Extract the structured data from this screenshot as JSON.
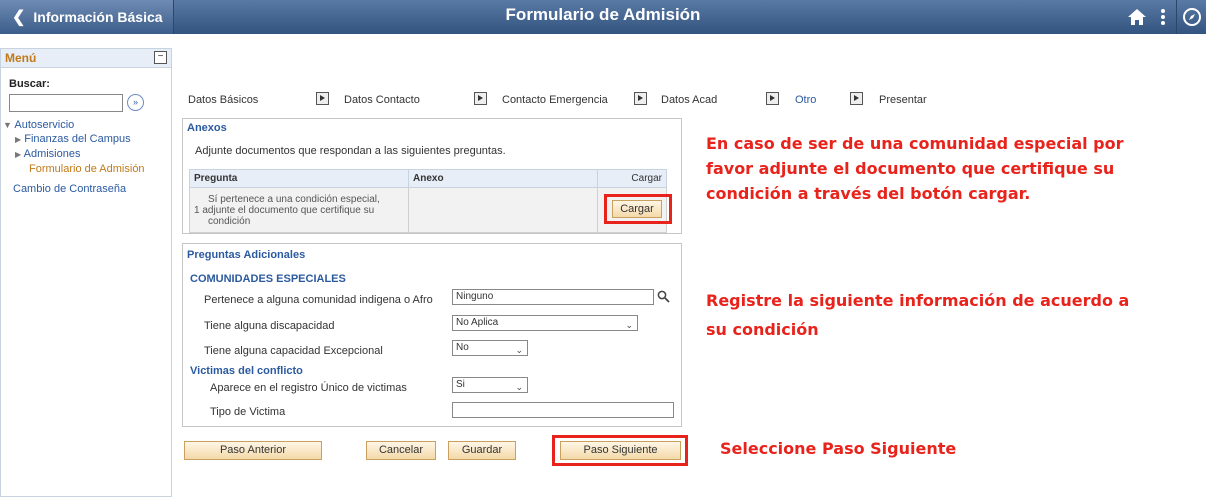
{
  "header": {
    "back_label": "Información Básica",
    "title": "Formulario de Admisión",
    "icons": [
      "home-icon",
      "more-vert-icon",
      "navigation-compass-icon"
    ]
  },
  "menu": {
    "title": "Menú",
    "search_label": "Buscar:",
    "search_value": "",
    "tree": {
      "root": "Autoservicio",
      "items": [
        {
          "label": "Finanzas del Campus"
        },
        {
          "label": "Admisiones"
        },
        {
          "label": "Formulario de Admisión"
        }
      ],
      "other": "Cambio de Contraseña"
    }
  },
  "steps": [
    "Datos Básicos",
    "Datos Contacto",
    "Contacto Emergencia",
    "Datos Acad",
    "Otro",
    "Presentar"
  ],
  "anexos": {
    "title": "Anexos",
    "instruction": "Adjunte documentos que respondan a las siguientes preguntas.",
    "headers": {
      "pregunta": "Pregunta",
      "anexo": "Anexo",
      "cargar": "Cargar"
    },
    "row": {
      "num": "1",
      "question_line1": "Sí pertenece a una condición especial,",
      "question_line2": "adjunte el documento que certifique su",
      "question_line3": "condición",
      "anexo": "",
      "button": "Cargar"
    }
  },
  "adicionales": {
    "title": "Preguntas Adicionales",
    "section1": "COMUNIDADES ESPECIALES",
    "q1_label": "Pertenece a alguna comunidad indigena o Afro",
    "q1_value": "Ninguno",
    "q2_label": "Tiene alguna discapacidad",
    "q2_value": "No Aplica",
    "q3_label": "Tiene alguna capacidad Excepcional",
    "q3_value": "No",
    "section2": "Victimas del conflicto",
    "q4_label": "Aparece en el registro Único de victimas",
    "q4_value": "Si",
    "q5_label": "Tipo de Victima",
    "q5_value": ""
  },
  "buttons": {
    "anterior": "Paso Anterior",
    "cancelar": "Cancelar",
    "guardar": "Guardar",
    "siguiente": "Paso Siguiente"
  },
  "annotations": {
    "a1_line1": "En caso de ser de una comunidad especial por",
    "a1_line2": "favor adjunte el documento que certifique su",
    "a1_line3": "condición a través del botón cargar.",
    "a2_line1": "Registre la siguiente información de acuerdo a",
    "a2_line2": "su condición",
    "a3": "Seleccione Paso Siguiente"
  },
  "colors": {
    "header_bg": "#3c5d8a",
    "link": "#2b5aa0",
    "annotation_red": "#e8231c",
    "button_bg": "#f3d9a8"
  }
}
